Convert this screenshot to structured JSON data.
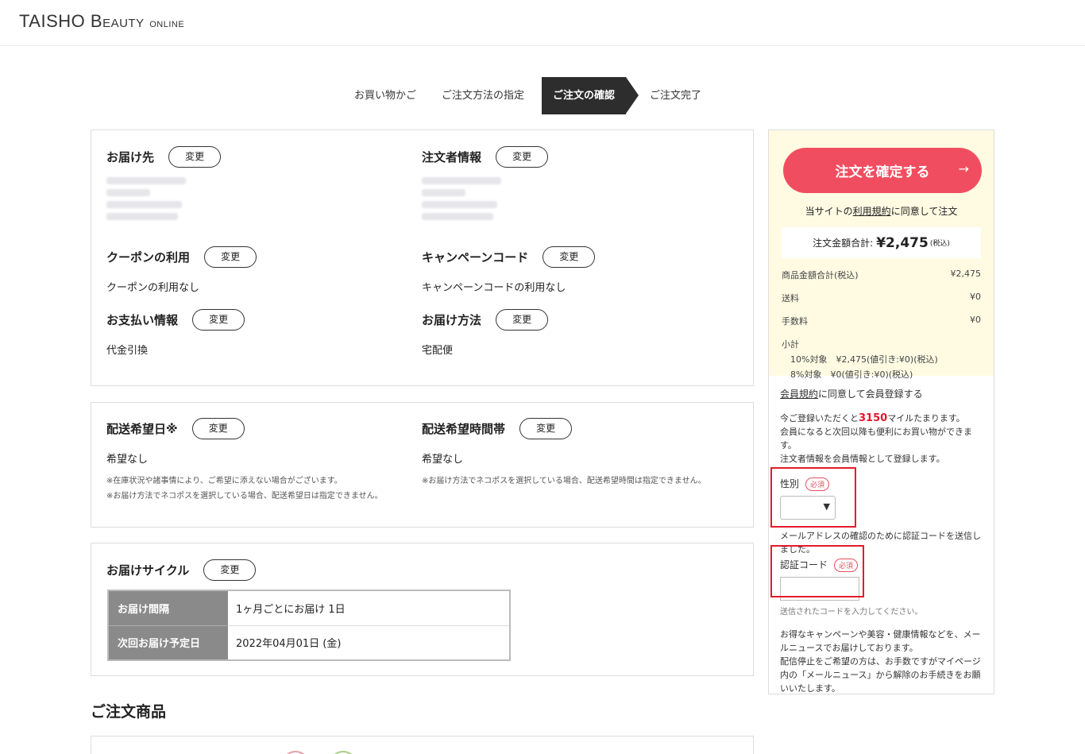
{
  "header": {
    "logo_main": "TAISHO",
    "logo_beauty": "Beauty",
    "logo_online": "online"
  },
  "steps": [
    {
      "label": "お買い物かご",
      "active": false
    },
    {
      "label": "ご注文方法の指定",
      "active": false
    },
    {
      "label": "ご注文の確認",
      "active": true
    },
    {
      "label": "ご注文完了",
      "active": false
    }
  ],
  "change_label": "変更",
  "box1": {
    "delivery": {
      "title": "お届け先"
    },
    "orderer": {
      "title": "注文者情報"
    },
    "coupon": {
      "title": "クーポンの利用",
      "value": "クーポンの利用なし"
    },
    "campaign": {
      "title": "キャンペーンコード",
      "value": "キャンペーンコードの利用なし"
    },
    "payment": {
      "title": "お支払い情報",
      "value": "代金引換"
    },
    "shipping": {
      "title": "お届け方法",
      "value": "宅配便"
    }
  },
  "box2": {
    "date": {
      "title": "配送希望日※",
      "value": "希望なし",
      "note1": "※在庫状況や諸事情により、ご希望に添えない場合がございます。",
      "note2": "※お届け方法でネコポスを選択している場合、配送希望日は指定できません。"
    },
    "time": {
      "title": "配送希望時間帯",
      "value": "希望なし",
      "note1": "※お届け方法でネコポスを選択している場合、配送希望時間は指定できません。"
    }
  },
  "box3": {
    "title": "お届けサイクル",
    "rows": [
      {
        "label": "お届け間隔",
        "value": "1ヶ月ごとにお届け 1日"
      },
      {
        "label": "次回お届け予定日",
        "value": "2022年04月01日 (金)"
      }
    ]
  },
  "products": {
    "title": "ご注文商品"
  },
  "side": {
    "confirm_button": "注文を確定する",
    "arrow": "→",
    "agree_prefix": "当サイトの",
    "agree_link": "利用規約",
    "agree_suffix": "に同意して注文",
    "total_label": "注文金額合計:",
    "total_amount": "¥2,475",
    "total_tax": "(税込)",
    "breakdown": [
      {
        "label": "商品金額合計(税込)",
        "value": "¥2,475"
      },
      {
        "label": "送料",
        "value": "¥0"
      },
      {
        "label": "手数料",
        "value": "¥0"
      }
    ],
    "subtotal_label": "小計",
    "subtotal_10": "10%対象　¥2,475(値引き:¥0)(税込)",
    "subtotal_8": "8%対象　¥0(値引き:¥0)(税込)",
    "register_link": "会員規約",
    "register_suffix": "に同意して会員登録する",
    "miles_prefix": "今ご登録いただくと",
    "miles_value": "3150",
    "miles_suffix": "マイルたまります。",
    "member_text": "会員になると次回以降も便利にお買い物ができます。",
    "orderer_text": "注文者情報を会員情報として登録します。",
    "gender_label": "性別",
    "required": "必須",
    "email_text": "メールアドレスの確認のために認証コードを送信しました。",
    "code_label": "認証コード",
    "code_hint": "送信されたコードを入力してください。",
    "news_text1": "お得なキャンペーンや美容・健康情報などを、メールニュースでお届けしております。",
    "news_text2": "配信停止をご希望の方は、お手数ですがマイページ内の「メールニュース」から解除のお手続きをお願いいたします。"
  },
  "colors": {
    "accent": "#f04e60",
    "highlight_box": "#e41c2a",
    "side_bg": "#fffbe3",
    "step_active": "#2d2d2d"
  }
}
